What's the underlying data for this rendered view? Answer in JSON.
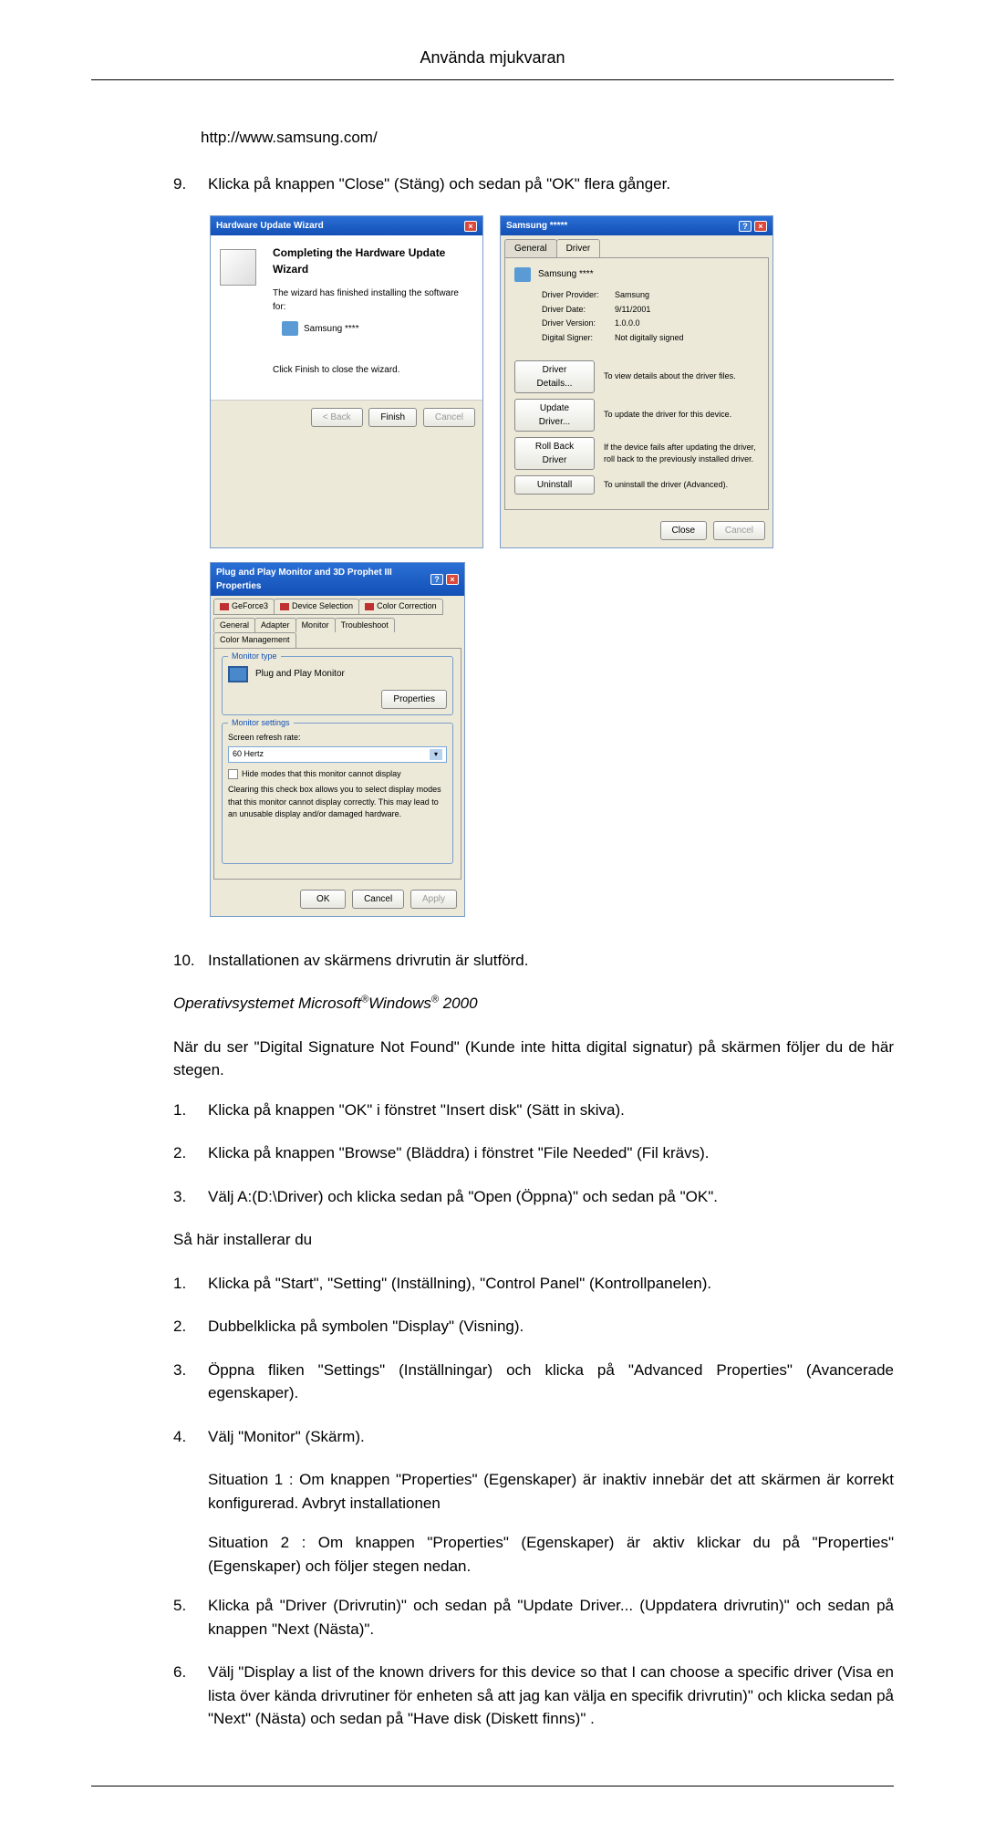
{
  "header": "Använda mjukvaran",
  "url": "http://www.samsung.com/",
  "step9": {
    "num": "9.",
    "text": "Klicka på knappen \"Close\" (Stäng) och sedan på \"OK\" flera gånger."
  },
  "wizard": {
    "title": "Hardware Update Wizard",
    "heading": "Completing the Hardware Update Wizard",
    "line1": "The wizard has finished installing the software for:",
    "device": "Samsung ****",
    "line2": "Click Finish to close the wizard.",
    "back": "< Back",
    "finish": "Finish",
    "cancel": "Cancel"
  },
  "driver": {
    "title": "Samsung *****",
    "tab1": "General",
    "tab2": "Driver",
    "device": "Samsung ****",
    "provider_l": "Driver Provider:",
    "provider_v": "Samsung",
    "date_l": "Driver Date:",
    "date_v": "9/11/2001",
    "version_l": "Driver Version:",
    "version_v": "1.0.0.0",
    "signer_l": "Digital Signer:",
    "signer_v": "Not digitally signed",
    "btn_details": "Driver Details...",
    "desc_details": "To view details about the driver files.",
    "btn_update": "Update Driver...",
    "desc_update": "To update the driver for this device.",
    "btn_rollback": "Roll Back Driver",
    "desc_rollback": "If the device fails after updating the driver, roll back to the previously installed driver.",
    "btn_uninstall": "Uninstall",
    "desc_uninstall": "To uninstall the driver (Advanced).",
    "close": "Close",
    "cancel": "Cancel"
  },
  "monitor": {
    "title": "Plug and Play Monitor and 3D Prophet III Properties",
    "tab_geforce": "GeForce3",
    "tab_devsel": "Device Selection",
    "tab_colorcorr": "Color Correction",
    "tab_general": "General",
    "tab_adapter": "Adapter",
    "tab_monitor": "Monitor",
    "tab_trouble": "Troubleshoot",
    "tab_colormgmt": "Color Management",
    "group_type": "Monitor type",
    "device": "Plug and Play Monitor",
    "btn_props": "Properties",
    "group_settings": "Monitor settings",
    "refresh_label": "Screen refresh rate:",
    "refresh_value": "60 Hertz",
    "hide_check": "Hide modes that this monitor cannot display",
    "hide_desc": "Clearing this check box allows you to select display modes that this monitor cannot display correctly. This may lead to an unusable display and/or damaged hardware.",
    "ok": "OK",
    "cancel": "Cancel",
    "apply": "Apply"
  },
  "step10": {
    "num": "10.",
    "text": "Installationen av skärmens drivrutin är slutförd."
  },
  "os_heading_pre": "Operativsystemet Microsoft",
  "os_heading_win": "Windows",
  "os_heading_post": " 2000",
  "reg_symbol": "®",
  "dsig_para": "När du ser \"Digital Signature Not Found\" (Kunde inte hitta digital signatur) på skärmen följer du de här stegen.",
  "dsig": {
    "s1_num": "1.",
    "s1": "Klicka på knappen \"OK\" i fönstret \"Insert disk\" (Sätt in skiva).",
    "s2_num": "2.",
    "s2": "Klicka på knappen \"Browse\" (Bläddra) i fönstret \"File Needed\" (Fil krävs).",
    "s3_num": "3.",
    "s3": "Välj A:(D:\\Driver) och klicka sedan på \"Open (Öppna)\" och sedan på \"OK\"."
  },
  "install_heading": "Så här installerar du",
  "inst": {
    "s1_num": "1.",
    "s1": "Klicka på \"Start\", \"Setting\" (Inställning), \"Control Panel\" (Kontrollpanelen).",
    "s2_num": "2.",
    "s2": "Dubbelklicka på symbolen \"Display\" (Visning).",
    "s3_num": "3.",
    "s3": "Öppna fliken \"Settings\" (Inställningar) och klicka på \"Advanced Properties\" (Avancerade egenskaper).",
    "s4_num": "4.",
    "s4": "Välj \"Monitor\" (Skärm).",
    "s4_sit1": "Situation 1 : Om knappen \"Properties\" (Egenskaper) är inaktiv innebär det att skärmen är korrekt konfigurerad. Avbryt installationen",
    "s4_sit2": "Situation 2 : Om knappen \"Properties\" (Egenskaper) är aktiv klickar du på \"Properties\" (Egenskaper) och följer stegen nedan.",
    "s5_num": "5.",
    "s5": "Klicka på \"Driver (Drivrutin)\" och sedan på \"Update Driver... (Uppdatera drivrutin)\" och sedan på knappen \"Next (Nästa)\".",
    "s6_num": "6.",
    "s6": "Välj \"Display a list of the known drivers for this device so that I can choose a specific driver (Visa en lista över kända drivrutiner för enheten så att jag kan välja en specifik drivrutin)\" och klicka sedan på \"Next\" (Nästa) och sedan på \"Have disk (Diskett finns)\" ."
  }
}
